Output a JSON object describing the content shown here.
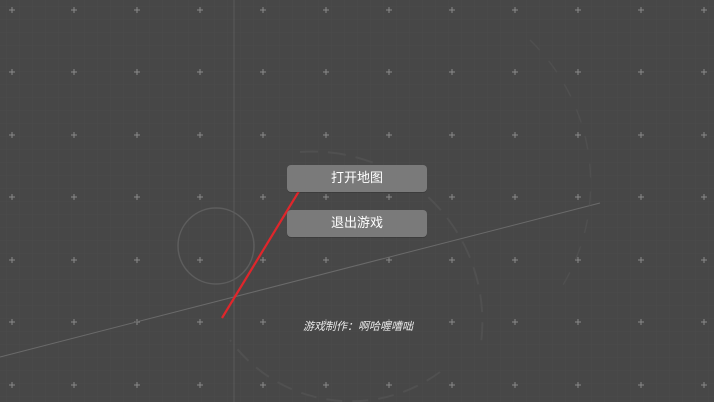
{
  "menu": {
    "open_map_label": "打开地图",
    "quit_game_label": "退出游戏"
  },
  "credits": {
    "text": "游戏制作：啊哈喔嘈咄"
  },
  "colors": {
    "background": "#474747",
    "grid_minor": "#4d4d4d",
    "grid_major": "#555555",
    "button_fill": "#7a7a7a",
    "arrow": "#e0262b"
  },
  "icons": {
    "pointer": "red-arrow-icon",
    "grid_marker": "plus-marker-icon"
  }
}
